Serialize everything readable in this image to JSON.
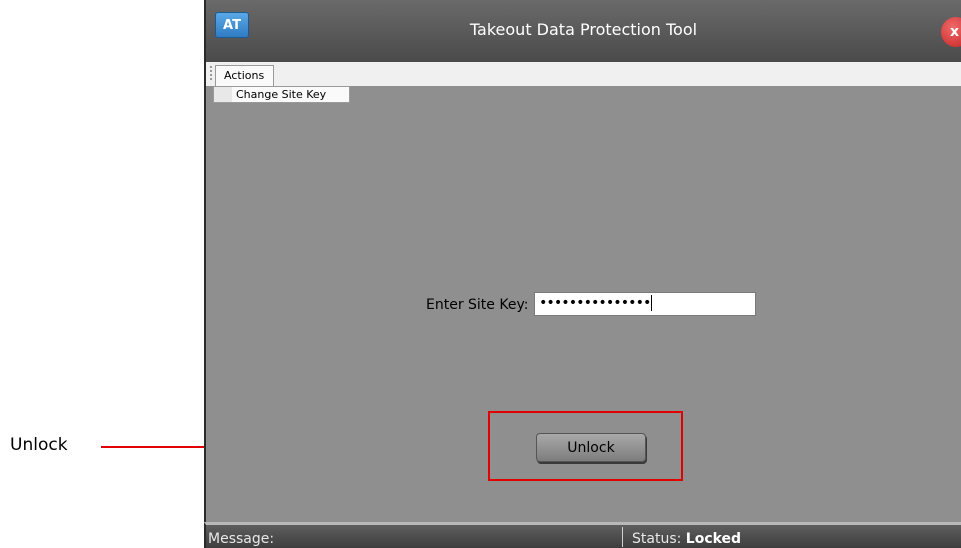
{
  "window": {
    "icon_text": "AT",
    "title": "Takeout Data Protection Tool",
    "close_label": "x"
  },
  "toolbar": {
    "tab_label": "Actions",
    "menu_item": "Change Site Key"
  },
  "form": {
    "site_key_label": "Enter Site Key:",
    "site_key_value": "•••••••••••••••",
    "unlock_label": "Unlock"
  },
  "statusbar": {
    "message_label": "Message:",
    "status_label": "Status:",
    "status_value": "Locked"
  },
  "annotation": {
    "label": "Unlock",
    "color": "#e00000"
  }
}
